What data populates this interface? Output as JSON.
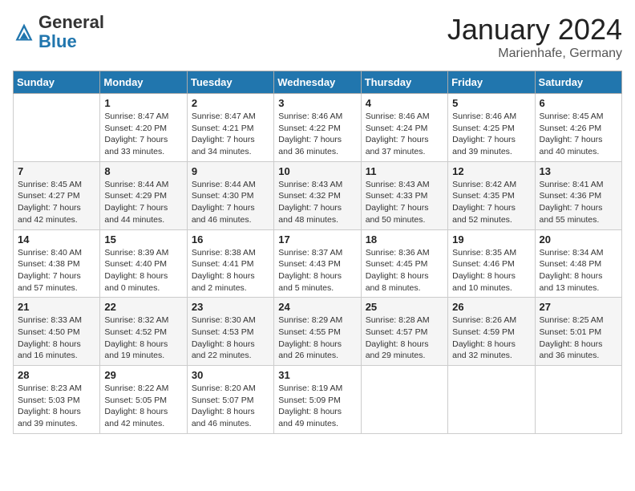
{
  "header": {
    "logo_general": "General",
    "logo_blue": "Blue",
    "month_title": "January 2024",
    "location": "Marienhafe, Germany"
  },
  "days_of_week": [
    "Sunday",
    "Monday",
    "Tuesday",
    "Wednesday",
    "Thursday",
    "Friday",
    "Saturday"
  ],
  "weeks": [
    [
      {
        "day": "",
        "sunrise": "",
        "sunset": "",
        "daylight": ""
      },
      {
        "day": "1",
        "sunrise": "Sunrise: 8:47 AM",
        "sunset": "Sunset: 4:20 PM",
        "daylight": "Daylight: 7 hours and 33 minutes."
      },
      {
        "day": "2",
        "sunrise": "Sunrise: 8:47 AM",
        "sunset": "Sunset: 4:21 PM",
        "daylight": "Daylight: 7 hours and 34 minutes."
      },
      {
        "day": "3",
        "sunrise": "Sunrise: 8:46 AM",
        "sunset": "Sunset: 4:22 PM",
        "daylight": "Daylight: 7 hours and 36 minutes."
      },
      {
        "day": "4",
        "sunrise": "Sunrise: 8:46 AM",
        "sunset": "Sunset: 4:24 PM",
        "daylight": "Daylight: 7 hours and 37 minutes."
      },
      {
        "day": "5",
        "sunrise": "Sunrise: 8:46 AM",
        "sunset": "Sunset: 4:25 PM",
        "daylight": "Daylight: 7 hours and 39 minutes."
      },
      {
        "day": "6",
        "sunrise": "Sunrise: 8:45 AM",
        "sunset": "Sunset: 4:26 PM",
        "daylight": "Daylight: 7 hours and 40 minutes."
      }
    ],
    [
      {
        "day": "7",
        "sunrise": "Sunrise: 8:45 AM",
        "sunset": "Sunset: 4:27 PM",
        "daylight": "Daylight: 7 hours and 42 minutes."
      },
      {
        "day": "8",
        "sunrise": "Sunrise: 8:44 AM",
        "sunset": "Sunset: 4:29 PM",
        "daylight": "Daylight: 7 hours and 44 minutes."
      },
      {
        "day": "9",
        "sunrise": "Sunrise: 8:44 AM",
        "sunset": "Sunset: 4:30 PM",
        "daylight": "Daylight: 7 hours and 46 minutes."
      },
      {
        "day": "10",
        "sunrise": "Sunrise: 8:43 AM",
        "sunset": "Sunset: 4:32 PM",
        "daylight": "Daylight: 7 hours and 48 minutes."
      },
      {
        "day": "11",
        "sunrise": "Sunrise: 8:43 AM",
        "sunset": "Sunset: 4:33 PM",
        "daylight": "Daylight: 7 hours and 50 minutes."
      },
      {
        "day": "12",
        "sunrise": "Sunrise: 8:42 AM",
        "sunset": "Sunset: 4:35 PM",
        "daylight": "Daylight: 7 hours and 52 minutes."
      },
      {
        "day": "13",
        "sunrise": "Sunrise: 8:41 AM",
        "sunset": "Sunset: 4:36 PM",
        "daylight": "Daylight: 7 hours and 55 minutes."
      }
    ],
    [
      {
        "day": "14",
        "sunrise": "Sunrise: 8:40 AM",
        "sunset": "Sunset: 4:38 PM",
        "daylight": "Daylight: 7 hours and 57 minutes."
      },
      {
        "day": "15",
        "sunrise": "Sunrise: 8:39 AM",
        "sunset": "Sunset: 4:40 PM",
        "daylight": "Daylight: 8 hours and 0 minutes."
      },
      {
        "day": "16",
        "sunrise": "Sunrise: 8:38 AM",
        "sunset": "Sunset: 4:41 PM",
        "daylight": "Daylight: 8 hours and 2 minutes."
      },
      {
        "day": "17",
        "sunrise": "Sunrise: 8:37 AM",
        "sunset": "Sunset: 4:43 PM",
        "daylight": "Daylight: 8 hours and 5 minutes."
      },
      {
        "day": "18",
        "sunrise": "Sunrise: 8:36 AM",
        "sunset": "Sunset: 4:45 PM",
        "daylight": "Daylight: 8 hours and 8 minutes."
      },
      {
        "day": "19",
        "sunrise": "Sunrise: 8:35 AM",
        "sunset": "Sunset: 4:46 PM",
        "daylight": "Daylight: 8 hours and 10 minutes."
      },
      {
        "day": "20",
        "sunrise": "Sunrise: 8:34 AM",
        "sunset": "Sunset: 4:48 PM",
        "daylight": "Daylight: 8 hours and 13 minutes."
      }
    ],
    [
      {
        "day": "21",
        "sunrise": "Sunrise: 8:33 AM",
        "sunset": "Sunset: 4:50 PM",
        "daylight": "Daylight: 8 hours and 16 minutes."
      },
      {
        "day": "22",
        "sunrise": "Sunrise: 8:32 AM",
        "sunset": "Sunset: 4:52 PM",
        "daylight": "Daylight: 8 hours and 19 minutes."
      },
      {
        "day": "23",
        "sunrise": "Sunrise: 8:30 AM",
        "sunset": "Sunset: 4:53 PM",
        "daylight": "Daylight: 8 hours and 22 minutes."
      },
      {
        "day": "24",
        "sunrise": "Sunrise: 8:29 AM",
        "sunset": "Sunset: 4:55 PM",
        "daylight": "Daylight: 8 hours and 26 minutes."
      },
      {
        "day": "25",
        "sunrise": "Sunrise: 8:28 AM",
        "sunset": "Sunset: 4:57 PM",
        "daylight": "Daylight: 8 hours and 29 minutes."
      },
      {
        "day": "26",
        "sunrise": "Sunrise: 8:26 AM",
        "sunset": "Sunset: 4:59 PM",
        "daylight": "Daylight: 8 hours and 32 minutes."
      },
      {
        "day": "27",
        "sunrise": "Sunrise: 8:25 AM",
        "sunset": "Sunset: 5:01 PM",
        "daylight": "Daylight: 8 hours and 36 minutes."
      }
    ],
    [
      {
        "day": "28",
        "sunrise": "Sunrise: 8:23 AM",
        "sunset": "Sunset: 5:03 PM",
        "daylight": "Daylight: 8 hours and 39 minutes."
      },
      {
        "day": "29",
        "sunrise": "Sunrise: 8:22 AM",
        "sunset": "Sunset: 5:05 PM",
        "daylight": "Daylight: 8 hours and 42 minutes."
      },
      {
        "day": "30",
        "sunrise": "Sunrise: 8:20 AM",
        "sunset": "Sunset: 5:07 PM",
        "daylight": "Daylight: 8 hours and 46 minutes."
      },
      {
        "day": "31",
        "sunrise": "Sunrise: 8:19 AM",
        "sunset": "Sunset: 5:09 PM",
        "daylight": "Daylight: 8 hours and 49 minutes."
      },
      {
        "day": "",
        "sunrise": "",
        "sunset": "",
        "daylight": ""
      },
      {
        "day": "",
        "sunrise": "",
        "sunset": "",
        "daylight": ""
      },
      {
        "day": "",
        "sunrise": "",
        "sunset": "",
        "daylight": ""
      }
    ]
  ]
}
